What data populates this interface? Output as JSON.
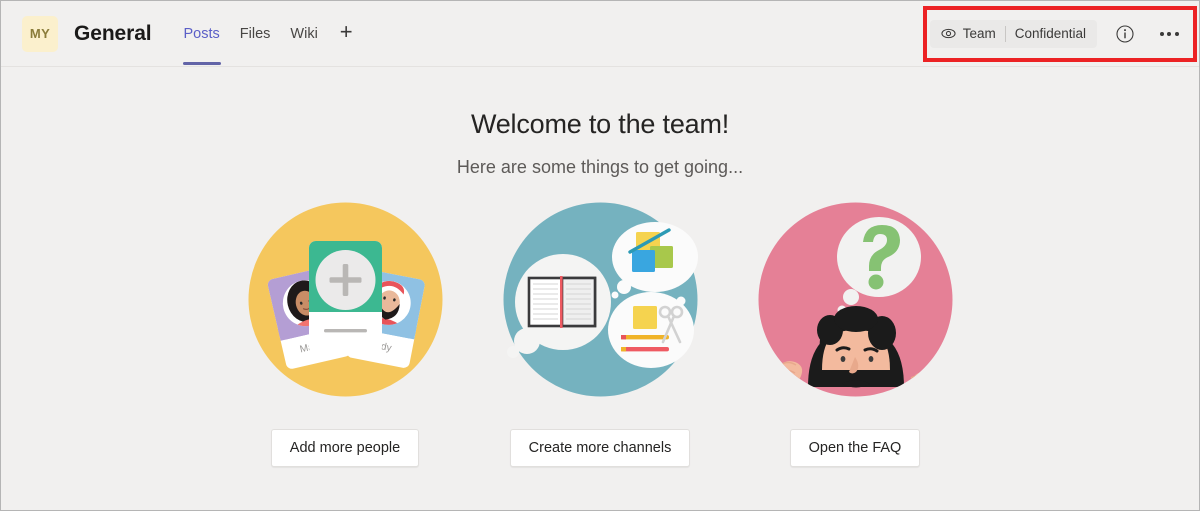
{
  "header": {
    "team_avatar_initials": "MY",
    "channel_name": "General",
    "tabs": [
      {
        "label": "Posts",
        "active": true
      },
      {
        "label": "Files",
        "active": false
      },
      {
        "label": "Wiki",
        "active": false
      }
    ],
    "add_tab_label": "+",
    "sensitivity": {
      "eye_icon": "eye-icon",
      "scope_label": "Team",
      "label": "Confidential"
    },
    "info_icon": "info-circle-icon",
    "more_icon": "ellipsis-icon",
    "annotation_color": "#ec2224"
  },
  "main": {
    "title": "Welcome to the team!",
    "subtitle": "Here are some things to get going...",
    "cards": [
      {
        "illustration": "people-cards-illustration",
        "circle_color": "#f5c75d",
        "person_name_1": "Maxine",
        "person_name_2": "Andy",
        "button_label": "Add more people"
      },
      {
        "illustration": "notebook-channels-illustration",
        "circle_color": "#75b2bf",
        "button_label": "Create more channels"
      },
      {
        "illustration": "question-faq-illustration",
        "circle_color": "#e58096",
        "button_label": "Open the FAQ"
      }
    ]
  },
  "colors": {
    "page_background": "#f1f0ef",
    "accent_purple": "#6264a7",
    "avatar_background": "#fbf0cd",
    "annotation_red": "#ec2224"
  }
}
